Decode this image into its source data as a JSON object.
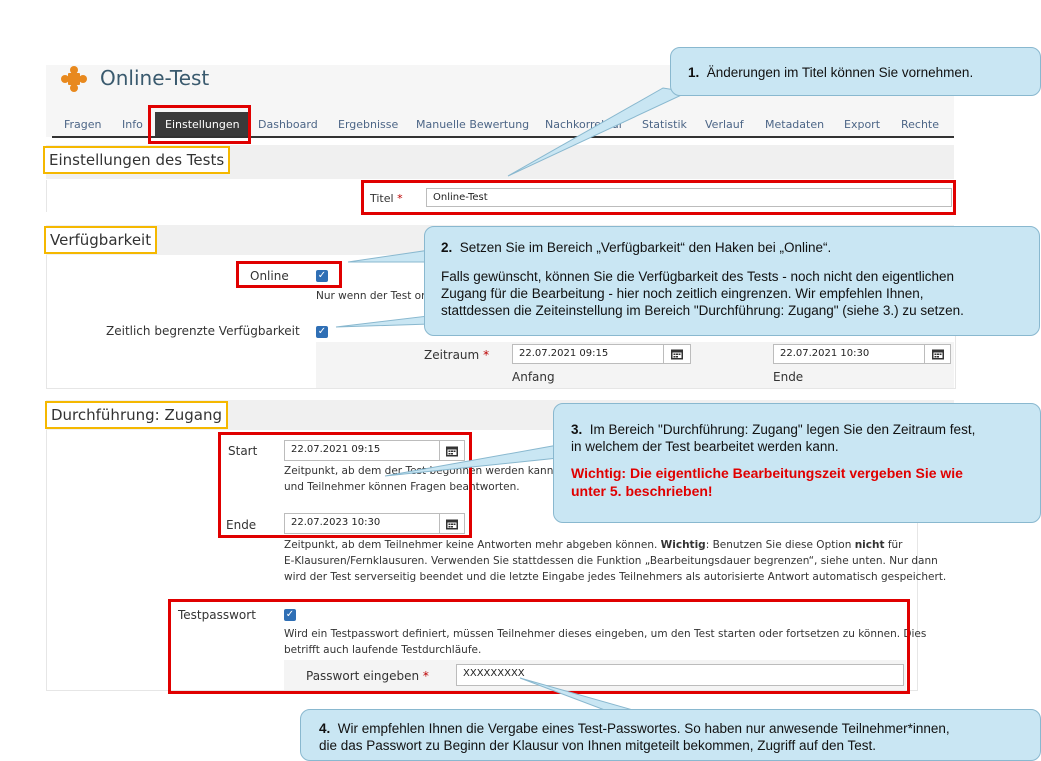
{
  "app": {
    "title": "Online-Test",
    "icon": "puzzle-icon"
  },
  "tabs": [
    "Fragen",
    "Info",
    "Einstellungen",
    "Dashboard",
    "Ergebnisse",
    "Manuelle Bewertung",
    "Nachkorrektur",
    "Statistik",
    "Verlauf",
    "Metadaten",
    "Export",
    "Rechte"
  ],
  "active_tab": "Einstellungen",
  "settings": {
    "section_title": "Einstellungen des Tests",
    "title_label": "Titel",
    "title_value": "Online-Test"
  },
  "availability": {
    "section_title": "Verfügbarkeit",
    "online_label": "Online",
    "online_hint": "Nur wenn der Test onl",
    "limited_label": "Zeitlich begrenzte Verfügbarkeit",
    "period_label": "Zeitraum",
    "start_value": "22.07.2021 09:15",
    "start_caption": "Anfang",
    "end_value": "22.07.2021 10:30",
    "end_caption": "Ende"
  },
  "access": {
    "section_title": "Durchführung: Zugang",
    "start_label": "Start",
    "start_value": "22.07.2021 09:15",
    "start_hint_1": "Zeitpunkt, ab dem der Test begonnen werden kann. A",
    "start_hint_2": "und Teilnehmer können Fragen beantworten.",
    "end_label": "Ende",
    "end_value": "22.07.2023 10:30",
    "end_hint_1a": "Zeitpunkt, ab dem Teilnehmer keine Antworten mehr abgeben können. ",
    "end_hint_1b": "Wichtig",
    "end_hint_1c": ": Benutzen Sie diese Option ",
    "end_hint_1d": "nicht",
    "end_hint_1e": " für",
    "end_hint_2": "E-Klausuren/Fernklausuren. Verwenden Sie stattdessen die Funktion „Bearbeitungsdauer begrenzen“, siehe unten. Nur dann",
    "end_hint_3": "wird der Test serverseitig beendet und die letzte Eingabe jedes Teilnehmers als autorisierte Antwort automatisch gespeichert.",
    "password_label": "Testpasswort",
    "password_hint_1": "Wird ein Testpasswort definiert, müssen Teilnehmer dieses eingeben, um den Test starten oder fortsetzen zu können. Dies",
    "password_hint_2": "betrifft auch laufende Testdurchläufe.",
    "password_input_label": "Passwort eingeben",
    "password_value": "XXXXXXXXX"
  },
  "callouts": {
    "c1_num": "1.",
    "c1_text": "Änderungen im Titel können Sie vornehmen.",
    "c2_num": "2.",
    "c2_line1": "Setzen Sie im Bereich „Verfügbarkeit“ den Haken bei „Online“.",
    "c2_line2": "Falls gewünscht, können Sie die Verfügbarkeit des Tests - noch nicht den eigentlichen",
    "c2_line3": "Zugang für die Bearbeitung - hier noch zeitlich eingrenzen. Wir empfehlen Ihnen,",
    "c2_line4": "stattdessen die Zeiteinstellung im Bereich \"Durchführung: Zugang\" (siehe 3.) zu setzen.",
    "c3_num": "3.",
    "c3_line1": "Im Bereich \"Durchführung: Zugang\" legen Sie den Zeitraum fest,",
    "c3_line2": "in welchem der Test bearbeitet werden kann.",
    "c3_warn1": "Wichtig: Die eigentliche Bearbeitungszeit vergeben Sie wie",
    "c3_warn2": "unter 5. beschrieben!",
    "c4_num": "4.",
    "c4_line1": "Wir empfehlen Ihnen die Vergabe eines Test-Passwortes. So haben nur anwesende Teilnehmer*innen,",
    "c4_line2": "die das Passwort zu Beginn der Klausur von Ihnen mitgeteilt bekommen, Zugriff auf den Test."
  },
  "colors": {
    "highlight_red": "#e00000",
    "section_yellow": "#f5b800",
    "callout_bg": "#c9e6f3",
    "checkbox_blue": "#2f6fb5"
  }
}
